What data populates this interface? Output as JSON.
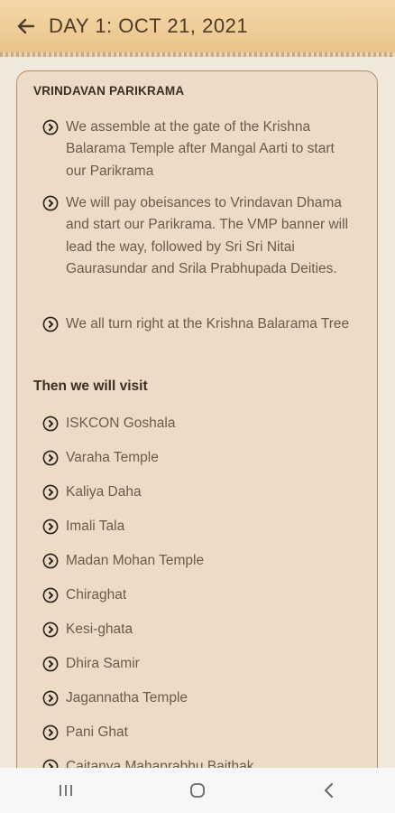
{
  "header": {
    "title": "DAY 1: OCT 21, 2021",
    "back_icon": "arrow-left-icon",
    "background": "#efcd98"
  },
  "card": {
    "title": "VRINDAVAN PARIKRAMA",
    "intro_items": [
      "We assemble at the gate of the Krishna Balarama Temple after Mangal Aarti to start our Parikrama",
      "We will pay obeisances to Vrindavan Dhama and start our Parikrama. The VMP banner will lead the way, followed by Sri Sri Nitai Gaurasundar and Srila Prabhupada Deities.",
      "We all turn right at the Krishna Balarama Tree"
    ],
    "subheading": "Then we will visit",
    "visit_items": [
      "ISKCON Goshala",
      "Varaha Temple",
      "Kaliya Daha",
      "Imali Tala",
      "Madan Mohan Temple",
      "Chiraghat",
      "Kesi-ghata",
      "Dhira Samir",
      "Jagannatha Temple",
      "Pani Ghat",
      "Caitanya Mahaprabhu Baithak"
    ],
    "bullet_icon": "circle-chevron-right-icon"
  },
  "system_nav": {
    "recents_icon": "recents-icon",
    "home_icon": "home-icon",
    "back_icon": "back-chevron-icon"
  }
}
